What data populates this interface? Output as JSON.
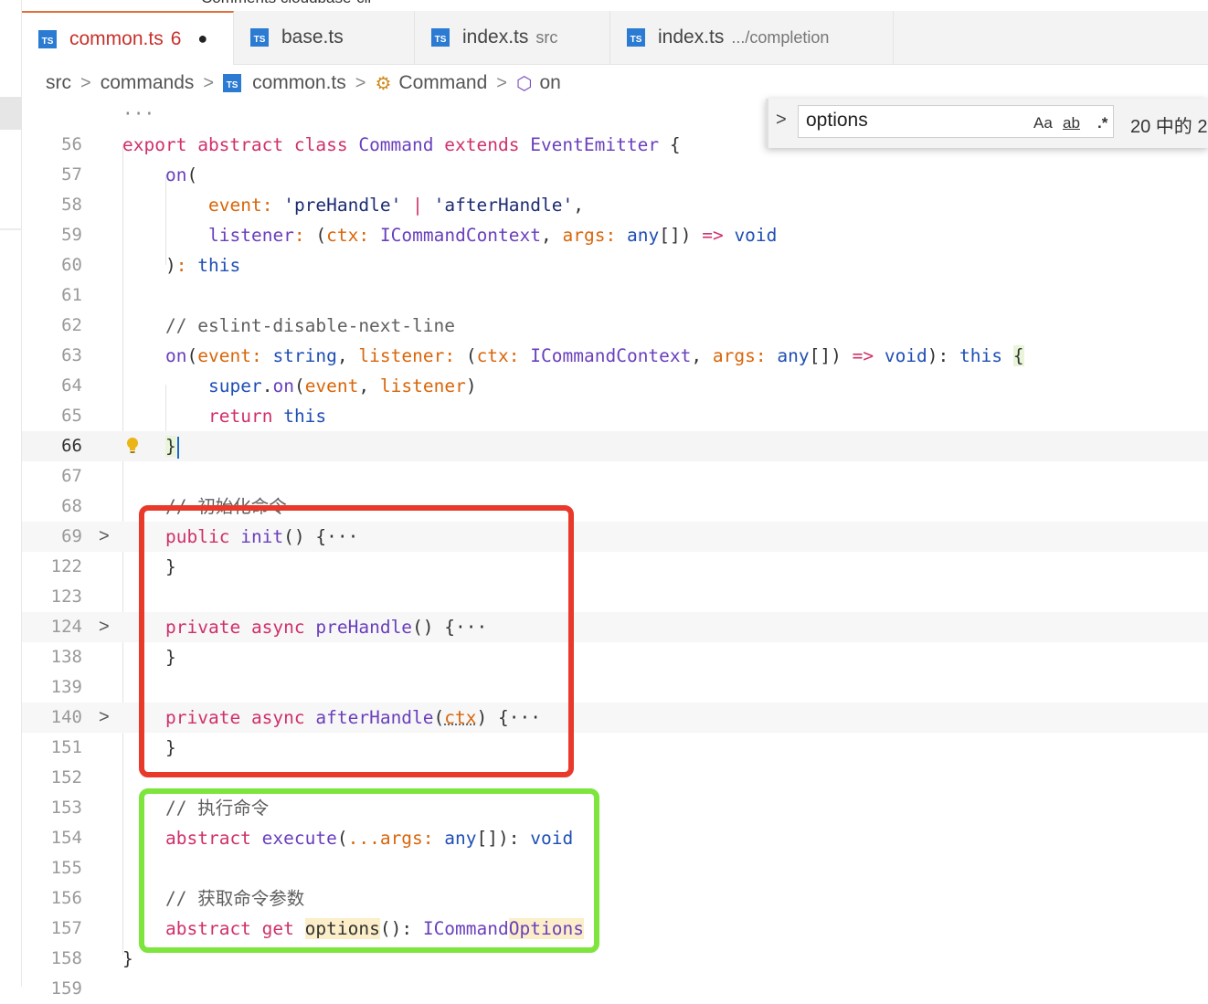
{
  "top_cut_text": "Comments   cloudbase-cli",
  "tabs": [
    {
      "label": "common.ts",
      "problems": "6",
      "dirty": "●",
      "desc": ""
    },
    {
      "label": "base.ts",
      "desc": ""
    },
    {
      "label": "index.ts",
      "desc": "src"
    },
    {
      "label": "index.ts",
      "desc": ".../completion"
    }
  ],
  "ts_badge": "TS",
  "breadcrumb": {
    "items": [
      "src",
      "commands",
      "common.ts",
      "Command",
      "on"
    ],
    "separator": ">"
  },
  "find": {
    "query": "options",
    "match_case": "Aa",
    "whole_word": "ab",
    "regex": ".*",
    "result": "20 中的 2"
  },
  "editor": {
    "ellipsis_top": "···",
    "current_line": "66",
    "folded_marker": "···"
  },
  "lines": [
    {
      "n": "56"
    },
    {
      "n": "57"
    },
    {
      "n": "58"
    },
    {
      "n": "59"
    },
    {
      "n": "60"
    },
    {
      "n": "61"
    },
    {
      "n": "62"
    },
    {
      "n": "63"
    },
    {
      "n": "64"
    },
    {
      "n": "65"
    },
    {
      "n": "66"
    },
    {
      "n": "67"
    },
    {
      "n": "68"
    },
    {
      "n": "69"
    },
    {
      "n": "122"
    },
    {
      "n": "123"
    },
    {
      "n": "124"
    },
    {
      "n": "138"
    },
    {
      "n": "139"
    },
    {
      "n": "140"
    },
    {
      "n": "151"
    },
    {
      "n": "152"
    },
    {
      "n": "153"
    },
    {
      "n": "154"
    },
    {
      "n": "155"
    },
    {
      "n": "156"
    },
    {
      "n": "157"
    },
    {
      "n": "158"
    },
    {
      "n": "159"
    }
  ],
  "code": {
    "l56": {
      "t1": "export",
      "t2": "abstract",
      "t3": "class",
      "t4": "Command",
      "t5": "extends",
      "t6": "EventEmitter",
      "t7": "{"
    },
    "l57": {
      "t1": "on",
      "t2": "("
    },
    "l58": {
      "t1": "event",
      "t2": ":",
      "t3": "'preHandle'",
      "t4": "|",
      "t5": "'afterHandle'",
      "t6": ","
    },
    "l59": {
      "t1": "listener",
      "t2": ":",
      "t3": "(",
      "t4": "ctx",
      "t5": ":",
      "t6": "ICommandContext",
      "t7": ",",
      "t8": "args",
      "t9": ":",
      "t10": "any",
      "t11": "[])",
      "t12": "=>",
      "t13": "void"
    },
    "l60": {
      "t1": ")",
      "t2": ":",
      "t3": "this"
    },
    "l62": {
      "t1": "// eslint-disable-next-line"
    },
    "l63": {
      "t1": "on",
      "t2": "(",
      "t3": "event",
      "t4": ":",
      "t5": "string",
      "t6": ",",
      "t7": "listener",
      "t8": ":",
      "t9": "(",
      "t10": "ctx",
      "t11": ":",
      "t12": "ICommandContext",
      "t13": ",",
      "t14": "args",
      "t15": ":",
      "t16": "any",
      "t17": "[])",
      "t18": "=>",
      "t19": "void",
      "t20": "):",
      "t21": "this",
      "t22": "{"
    },
    "l64": {
      "t1": "super",
      "t2": ".",
      "t3": "on",
      "t4": "(",
      "t5": "event",
      "t6": ",",
      "t7": "listener",
      "t8": ")"
    },
    "l65": {
      "t1": "return",
      "t2": "this"
    },
    "l66": {
      "t1": "}"
    },
    "l68": {
      "t1": "// 初始化命令"
    },
    "l69": {
      "t1": "public",
      "t2": "init",
      "t3": "()",
      "t4": "{"
    },
    "l122": {
      "t1": "}"
    },
    "l124": {
      "t1": "private",
      "t2": "async",
      "t3": "preHandle",
      "t4": "()",
      "t5": "{"
    },
    "l138": {
      "t1": "}"
    },
    "l140": {
      "t1": "private",
      "t2": "async",
      "t3": "afterHandle",
      "t4": "(",
      "t5": "ctx",
      "t6": ")",
      "t7": "{"
    },
    "l151": {
      "t1": "}"
    },
    "l153": {
      "t1": "// 执行命令"
    },
    "l154": {
      "t1": "abstract",
      "t2": "execute",
      "t3": "(",
      "t4": "...args",
      "t5": ":",
      "t6": "any",
      "t7": "[]):",
      "t8": "void"
    },
    "l156": {
      "t1": "// 获取命令参数"
    },
    "l157": {
      "t1": "abstract",
      "t2": "get",
      "t3": "options",
      "t4": "():",
      "t5": "ICommand",
      "t6": "Options"
    },
    "l158": {
      "t1": "}"
    }
  },
  "colors": {
    "keyword": "#d0306b",
    "type_keyword": "#1f4fb5",
    "function": "#6a3fbd",
    "parameter": "#d9660a",
    "annotation_red": "#e8392a",
    "annotation_green": "#7de53d",
    "ts_icon": "#2b7bd3",
    "active_tab_text": "#c7312b"
  },
  "icons": [
    "ts-file-icon",
    "class-icon",
    "method-cube-icon",
    "lightbulb-icon",
    "chevron-right-icon",
    "close-dot-icon"
  ]
}
